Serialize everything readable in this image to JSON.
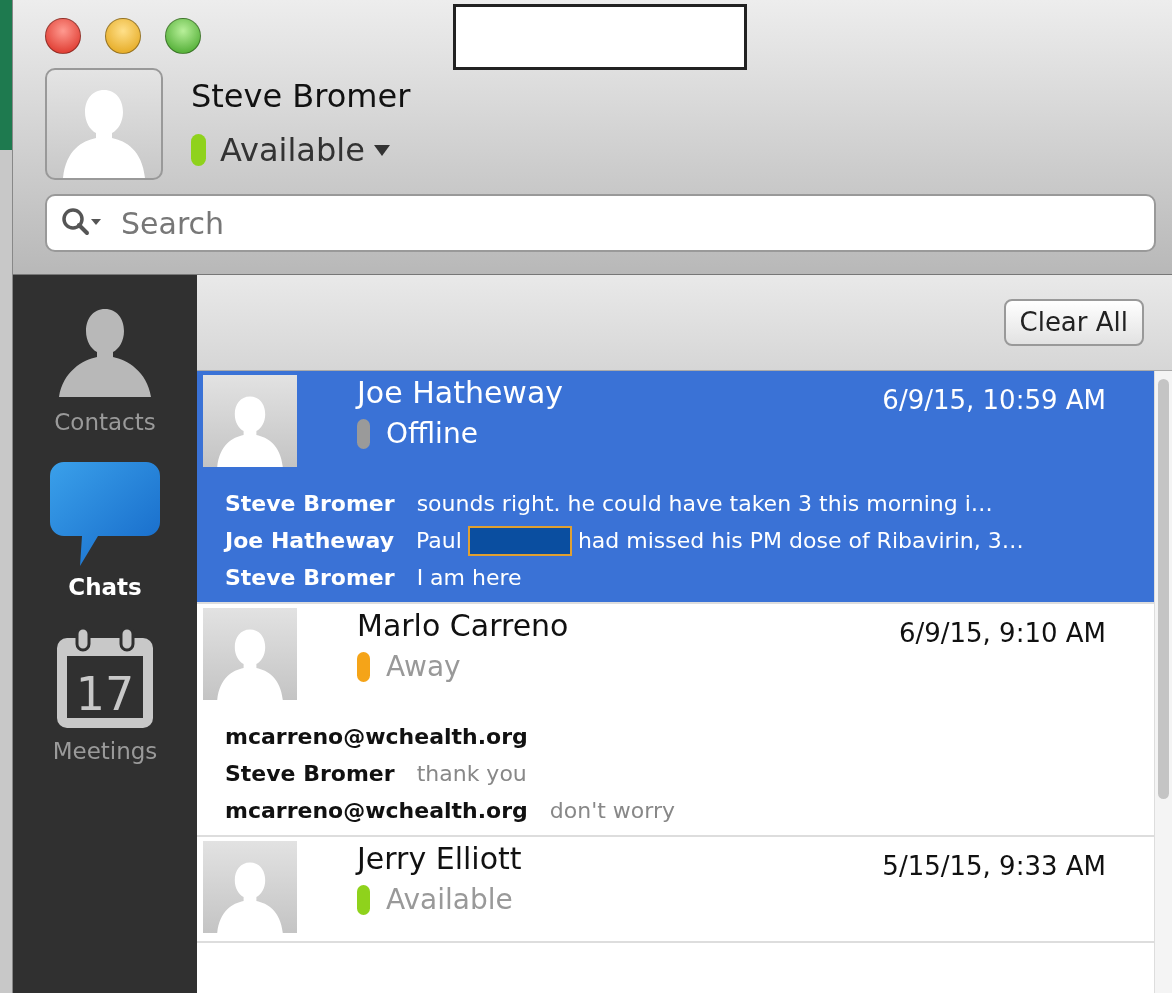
{
  "profile": {
    "name": "Steve Bromer",
    "status": {
      "label": "Available",
      "color": "#8fd21c"
    }
  },
  "search": {
    "placeholder": "Search"
  },
  "sidebar": {
    "items": [
      {
        "kind": "contacts",
        "label": "Contacts",
        "selected": false
      },
      {
        "kind": "chats",
        "label": "Chats",
        "selected": true
      },
      {
        "kind": "meetings",
        "label": "Meetings",
        "selected": false,
        "icon_text": "17"
      }
    ]
  },
  "toolbar": {
    "clear_button": "Clear All"
  },
  "conversations": [
    {
      "name": "Joe Hatheway",
      "time": "6/9/15, 10:59 AM",
      "status": {
        "label": "Offline",
        "color": "#9a9a9a"
      },
      "selected": true,
      "messages": [
        {
          "sender": "Steve Bromer",
          "segments": [
            {
              "kind": "text",
              "text": "sounds right.  he could have taken 3 this morning i…"
            }
          ]
        },
        {
          "sender": "Joe Hatheway",
          "segments": [
            {
              "kind": "text",
              "text": "Paul"
            },
            {
              "kind": "redaction"
            },
            {
              "kind": "text",
              "text": "had missed his PM dose of Ribavirin, 3…"
            }
          ]
        },
        {
          "sender": "Steve Bromer",
          "segments": [
            {
              "kind": "text",
              "text": "I am here"
            }
          ]
        }
      ]
    },
    {
      "name": "Marlo Carreno",
      "time": "6/9/15, 9:10 AM",
      "status": {
        "label": "Away",
        "color": "#f5a418"
      },
      "selected": false,
      "messages": [
        {
          "sender": "mcarreno@wchealth.org"
        },
        {
          "sender": "Steve Bromer",
          "segments": [
            {
              "kind": "text",
              "text": "thank you"
            }
          ]
        },
        {
          "sender": "mcarreno@wchealth.org",
          "segments": [
            {
              "kind": "text",
              "text": "don't worry"
            }
          ]
        }
      ]
    },
    {
      "name": "Jerry Elliott",
      "time": "5/15/15, 9:33 AM",
      "status": {
        "label": "Available",
        "color": "#8fd21c"
      },
      "selected": false
    }
  ]
}
